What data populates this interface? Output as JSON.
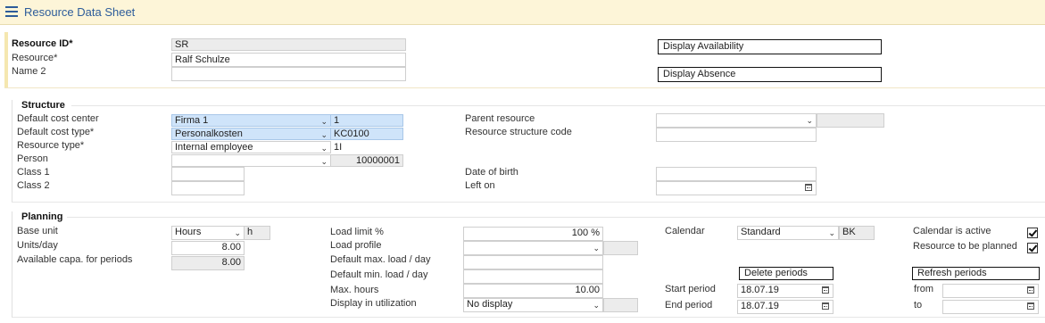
{
  "app": {
    "title": "Resource Data Sheet"
  },
  "header": {
    "resource_id_label": "Resource ID*",
    "resource_id_value": "SR",
    "resource_label": "Resource*",
    "resource_value": "Ralf Schulze",
    "name2_label": "Name 2",
    "name2_value": "",
    "display_availability": "Display Availability",
    "display_absence": "Display Absence"
  },
  "structure": {
    "title": "Structure",
    "cost_center_label": "Default cost center",
    "cost_center_value": "Firma 1",
    "cost_center_code": "1",
    "cost_type_label": "Default cost type*",
    "cost_type_value": "Personalkosten",
    "cost_type_code": "KC0100",
    "resource_type_label": "Resource type*",
    "resource_type_value": "Internal employee",
    "resource_type_code": "1I",
    "person_label": "Person",
    "person_value": "",
    "person_code": "10000001",
    "class1_label": "Class 1",
    "class2_label": "Class 2",
    "parent_resource_label": "Parent resource",
    "structure_code_label": "Resource structure code",
    "dob_label": "Date of birth",
    "left_on_label": "Left on"
  },
  "planning": {
    "title": "Planning",
    "base_unit_label": "Base unit",
    "base_unit_value": "Hours",
    "base_unit_code": "h",
    "units_day_label": "Units/day",
    "units_day_value": "8.00",
    "avail_capa_label": "Available capa. for periods",
    "avail_capa_value": "8.00",
    "load_limit_label": "Load limit %",
    "load_limit_value": "100 %",
    "load_profile_label": "Load profile",
    "max_load_label": "Default max. load / day",
    "min_load_label": "Default min. load / day",
    "max_hours_label": "Max. hours",
    "max_hours_value": "10.00",
    "display_util_label": "Display in utilization",
    "display_util_value": "No display",
    "calendar_label": "Calendar",
    "calendar_value": "Standard",
    "calendar_code": "BK",
    "delete_periods": "Delete periods",
    "start_period_label": "Start period",
    "start_period_value": "18.07.19",
    "end_period_label": "End period",
    "end_period_value": "18.07.19",
    "calendar_active_label": "Calendar is active",
    "to_be_planned_label": "Resource to be planned",
    "refresh_periods": "Refresh periods",
    "from_label": "from",
    "to_label": "to"
  },
  "icons": {
    "menu": "hamburger-menu-icon",
    "dropdown": "chevron-down-icon",
    "date": "calendar-icon",
    "check": "checkmark-icon"
  },
  "colors": {
    "title_text": "#2d5c9a",
    "titlebar_bg": "#fdf5d8",
    "selected_bg": "#cfe4fa",
    "readonly_bg": "#ececec"
  }
}
